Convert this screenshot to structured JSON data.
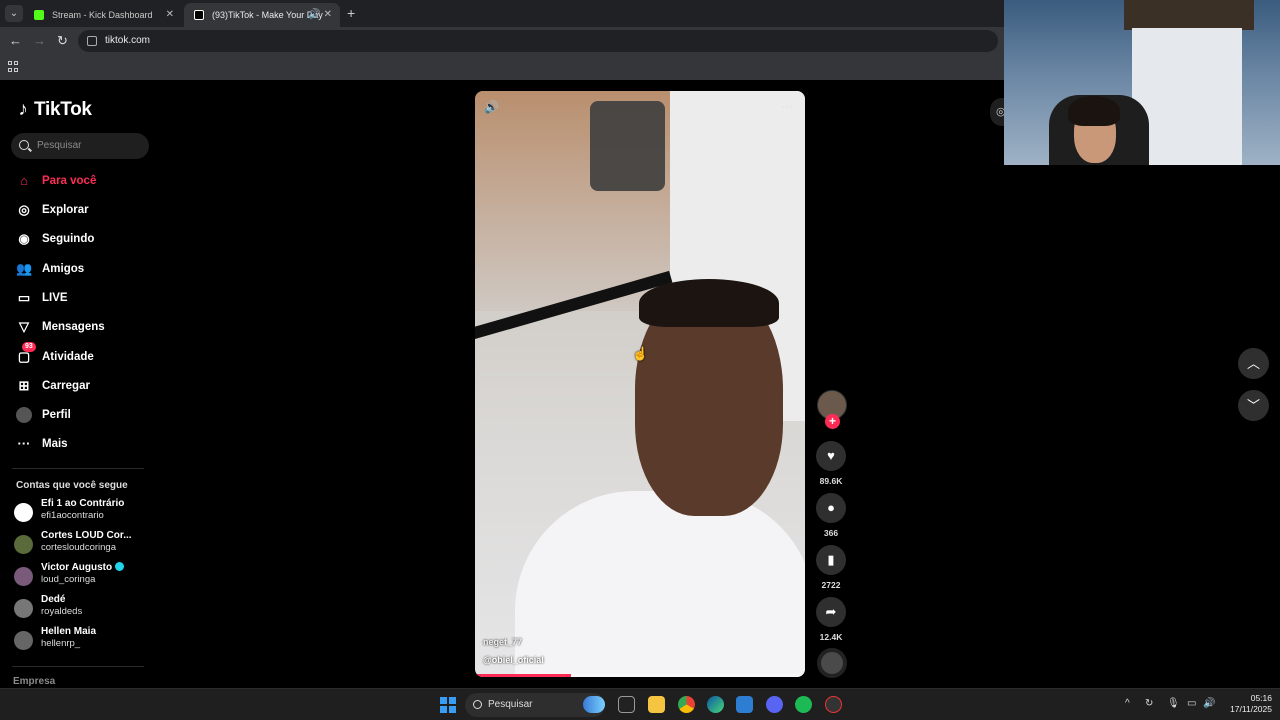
{
  "browser": {
    "tabs": [
      {
        "title": "Stream - Kick Dashboard",
        "favicon_color": "#53fc18"
      },
      {
        "title": "(93)TikTok - Make Your Day",
        "favicon_color": "#ffffff"
      }
    ],
    "url": "tiktok.com"
  },
  "tiktok": {
    "logo": "TikTok",
    "search_placeholder": "Pesquisar",
    "nav": [
      {
        "label": "Para você",
        "icon": "home-icon"
      },
      {
        "label": "Explorar",
        "icon": "compass-icon"
      },
      {
        "label": "Seguindo",
        "icon": "following-icon"
      },
      {
        "label": "Amigos",
        "icon": "friends-icon"
      },
      {
        "label": "LIVE",
        "icon": "live-icon"
      },
      {
        "label": "Mensagens",
        "icon": "messages-icon"
      },
      {
        "label": "Atividade",
        "icon": "activity-icon",
        "badge": "93"
      },
      {
        "label": "Carregar",
        "icon": "upload-icon"
      },
      {
        "label": "Perfil",
        "icon": "profile-icon"
      },
      {
        "label": "Mais",
        "icon": "more-icon"
      }
    ],
    "following_title": "Contas que você segue",
    "following": [
      {
        "name": "Efi 1 ao Contrário",
        "handle": "efi1aocontrario"
      },
      {
        "name": "Cortes LOUD Cor...",
        "handle": "cortesloudcoringa"
      },
      {
        "name": "Victor Augusto",
        "handle": "loud_coringa",
        "verified": true
      },
      {
        "name": "Dedé",
        "handle": "royaldeds"
      },
      {
        "name": "Hellen Maia",
        "handle": "hellenrp_"
      }
    ],
    "footer": "Empresa",
    "video": {
      "overlay_user": "neget_77",
      "author": "@obiel_oficial",
      "progress": 0.29
    },
    "actions": {
      "likes": "89.6K",
      "comments": "366",
      "saves": "2722",
      "shares": "12.4K"
    }
  },
  "taskbar": {
    "search": "Pesquisar",
    "time": "05:16",
    "date": "17/11/2025"
  },
  "colors": {
    "accent": "#fe2c55"
  }
}
